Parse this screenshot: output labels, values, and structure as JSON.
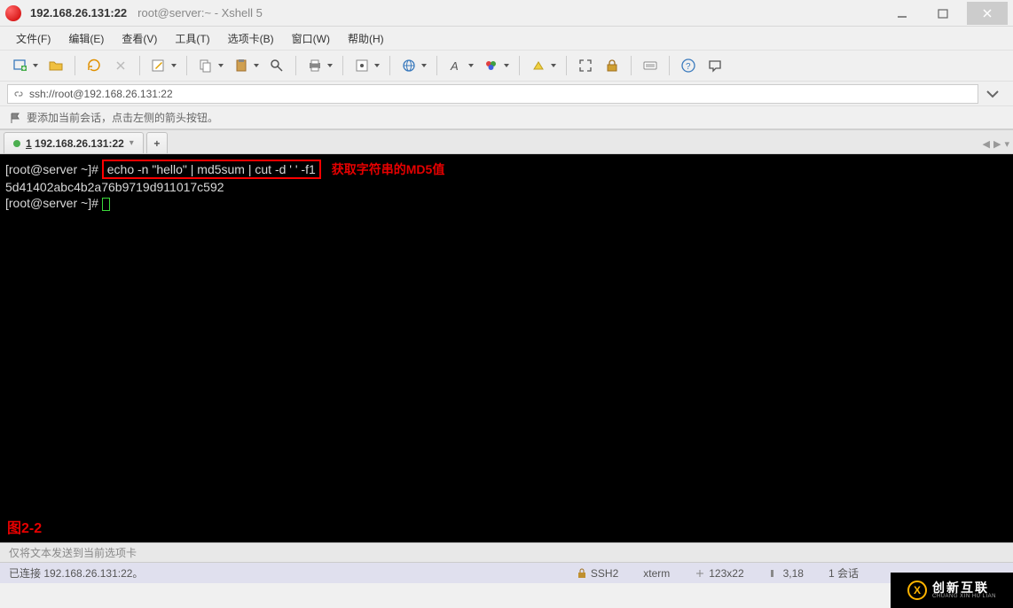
{
  "title_bar": {
    "address": "192.168.26.131:22",
    "session": "root@server:~ - Xshell 5"
  },
  "menu": {
    "file": "文件(F)",
    "edit": "编辑(E)",
    "view": "查看(V)",
    "tools": "工具(T)",
    "tabs": "选项卡(B)",
    "window": "窗口(W)",
    "help": "帮助(H)"
  },
  "toolbar": {
    "icons": [
      "new-session-icon",
      "open-icon",
      "reconnect-icon",
      "edit-icon",
      "compose-icon",
      "copy-icon",
      "paste-icon",
      "search-icon",
      "print-icon",
      "properties-icon",
      "web-icon",
      "font-icon",
      "color-icon",
      "highlight-icon",
      "fullscreen-icon",
      "transparency-icon",
      "lock-icon",
      "keymap-icon",
      "help-icon",
      "speech-icon"
    ]
  },
  "address_bar": {
    "url": "ssh://root@192.168.26.131:22"
  },
  "hint": {
    "text": "要添加当前会话，点击左侧的箭头按钮。"
  },
  "tabs": {
    "active_label": "1 192.168.26.131:22",
    "add": "+"
  },
  "terminal": {
    "prompt1": "[root@server ~]# ",
    "command": "echo -n \"hello\" | md5sum | cut -d ' ' -f1",
    "annotation": "获取字符串的MD5值",
    "output": "5d41402abc4b2a76b9719d911017c592",
    "prompt2": "[root@server ~]# ",
    "figure_label": "图2-2"
  },
  "hint2": "仅将文本发送到当前选项卡",
  "status": {
    "connection": "已连接 192.168.26.131:22。",
    "proto": "SSH2",
    "termtype": "xterm",
    "size": "123x22",
    "pos": "3,18",
    "sessions": "1 会话"
  },
  "watermark": {
    "zh": "创新互联",
    "en": "CHUANG XIN HU LIAN"
  }
}
